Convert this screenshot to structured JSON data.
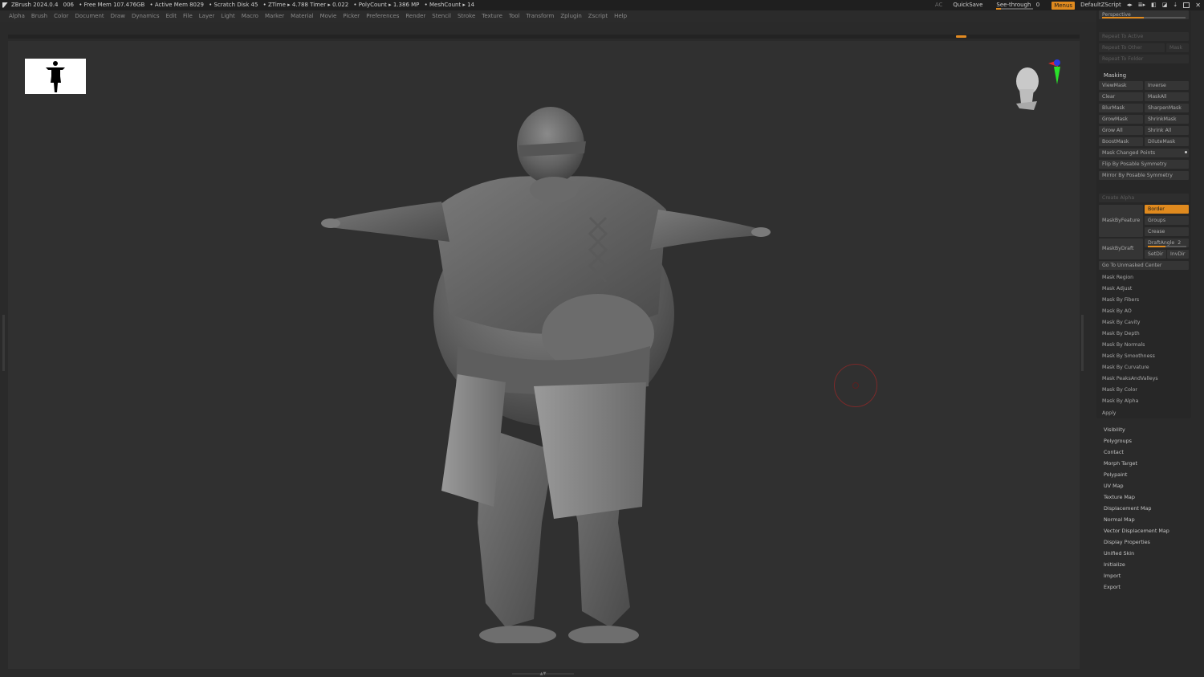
{
  "titlebar": {
    "app": "ZBrush 2024.0.4",
    "doc_num": "006",
    "free_mem": "• Free Mem 107.476GB",
    "active_mem": "• Active Mem 8029",
    "scratch": "• Scratch Disk 45",
    "ztime": "• ZTime ▸ 4.788 Timer ▸ 0.022",
    "polycount": "• PolyCount ▸ 1.386 MP",
    "meshcount": "• MeshCount ▸ 14",
    "ac_label": "AC",
    "quicksave": "QuickSave",
    "see_through_label": "See-through",
    "see_through_value": "0",
    "see_through_level": 0.0,
    "menus": "Menus",
    "script": "DefaultZScript"
  },
  "menubar": {
    "items": [
      "Alpha",
      "Brush",
      "Color",
      "Document",
      "Draw",
      "Dynamics",
      "Edit",
      "File",
      "Layer",
      "Light",
      "Macro",
      "Marker",
      "Material",
      "Movie",
      "Picker",
      "Preferences",
      "Render",
      "Stencil",
      "Stroke",
      "Texture",
      "Tool",
      "Transform",
      "Zplugin",
      "Zscript",
      "Help"
    ]
  },
  "panel": {
    "perspective": "Perspective",
    "repeat_to_active": "Repeat To Active",
    "repeat_to_other": "Repeat To Other",
    "mask_small": "Mask",
    "repeat_to_folder": "Repeat To Folder",
    "masking_title": "Masking",
    "view_mask": "ViewMask",
    "inverse": "Inverse",
    "clear": "Clear",
    "mask_all": "MaskAll",
    "blur_mask": "BlurMask",
    "sharpen_mask": "SharpenMask",
    "grow_mask": "GrowMask",
    "shrink_mask": "ShrinkMask",
    "grow_all": "Grow All",
    "shrink_all": "Shrink All",
    "boost_mask": "BoostMask",
    "dilute_mask": "DiluteMask",
    "mask_changed_points": "Mask Changed Points",
    "flip_symmetry": "Flip By Posable Symmetry",
    "mirror_symmetry": "Mirror By Posable Symmetry",
    "create_alpha": "Create Alpha",
    "border": "Border",
    "mask_by_feature": "MaskByFeature",
    "groups": "Groups",
    "crease": "Crease",
    "mask_by_draft": "MaskByDraft",
    "draft_angle": "DraftAngle",
    "draft_angle_value": "2",
    "set_dir": "SetDir",
    "inv_dir": "InvDir",
    "go_to_unmasked": "Go To Unmasked Center",
    "mask_items": [
      "Mask Region",
      "Mask Adjust",
      "Mask By Fibers",
      "Mask By AO",
      "Mask By Cavity",
      "Mask By Depth",
      "Mask By Normals",
      "Mask By Smoothness",
      "Mask By Curvature",
      "Mask PeaksAndValleys",
      "Mask By Color",
      "Mask By Alpha",
      "Apply"
    ],
    "subpalettes": [
      "Visibility",
      "Polygroups",
      "Contact",
      "Morph Target",
      "Polypaint",
      "UV Map",
      "Texture Map",
      "Displacement Map",
      "Normal Map",
      "Vector Displacement Map",
      "Display Properties",
      "Unified Skin",
      "Initialize",
      "Import",
      "Export"
    ]
  },
  "icons": {
    "logo": "zbrush-logo-icon",
    "nav": "navigation-head-icon",
    "cursor": "brush-cursor-icon"
  },
  "colors": {
    "accent": "#e08a1e",
    "panel": "#272727",
    "viewport": "#303030"
  }
}
